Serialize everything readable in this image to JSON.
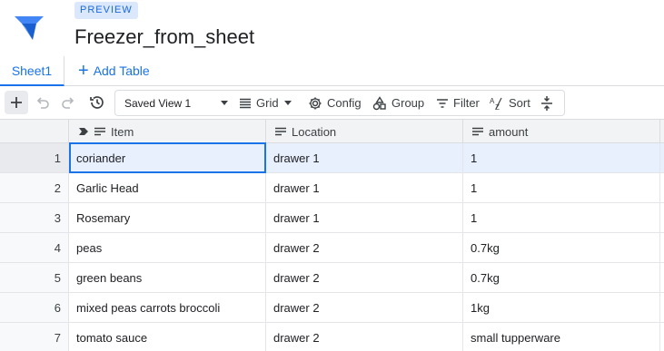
{
  "app": {
    "badge": "PREVIEW",
    "title": "Freezer_from_sheet"
  },
  "tabs": {
    "active": "Sheet1",
    "add_table": "Add Table"
  },
  "toolbar": {
    "view_name": "Saved View 1",
    "grid": "Grid",
    "config": "Config",
    "group": "Group",
    "filter": "Filter",
    "sort": "Sort"
  },
  "table": {
    "columns": [
      "Item",
      "Location",
      "amount"
    ],
    "rows": [
      {
        "num": "1",
        "item": "coriander",
        "location": "drawer 1",
        "amount": "1"
      },
      {
        "num": "2",
        "item": "Garlic Head",
        "location": "drawer 1",
        "amount": "1"
      },
      {
        "num": "3",
        "item": "Rosemary",
        "location": "drawer 1",
        "amount": "1"
      },
      {
        "num": "4",
        "item": "peas",
        "location": "drawer 2",
        "amount": "0.7kg"
      },
      {
        "num": "5",
        "item": "green beans",
        "location": "drawer 2",
        "amount": "0.7kg"
      },
      {
        "num": "6",
        "item": "mixed peas carrots broccoli",
        "location": "drawer 2",
        "amount": "1kg"
      },
      {
        "num": "7",
        "item": "tomato sauce",
        "location": "drawer 2",
        "amount": "small tupperware"
      }
    ]
  },
  "colors": {
    "accent": "#1a73e8",
    "selected_row": "#e8f0fe"
  }
}
